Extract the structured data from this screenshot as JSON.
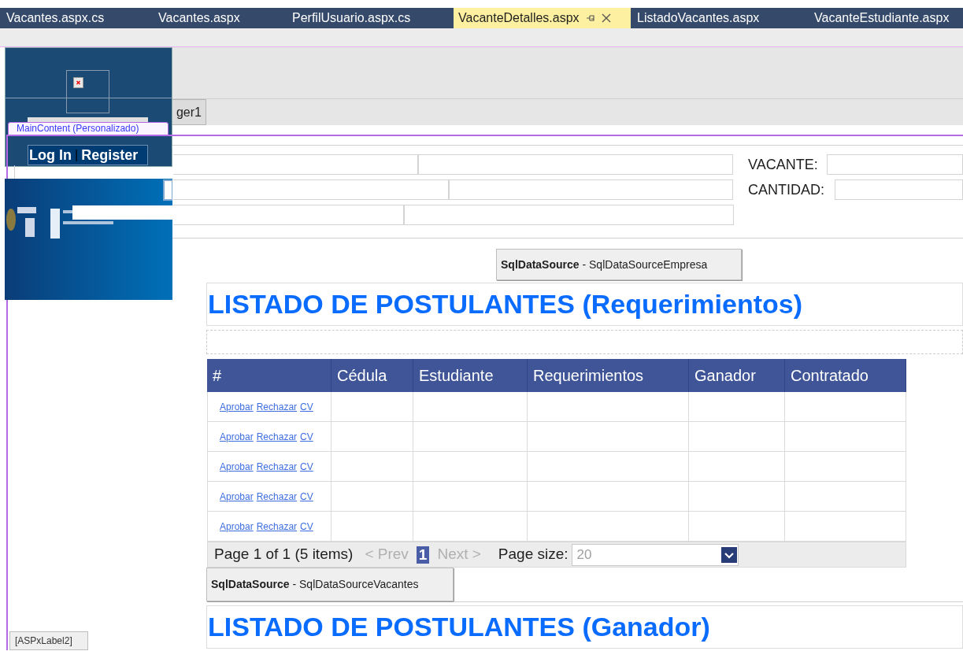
{
  "tabs": [
    {
      "label": "Vacantes.aspx.cs",
      "selected": false
    },
    {
      "label": "Vacantes.aspx",
      "selected": false
    },
    {
      "label": "PerfilUsuario.aspx.cs",
      "selected": false
    },
    {
      "label": "VacanteDetalles.aspx",
      "selected": true
    },
    {
      "label": "ListadoVacantes.aspx",
      "selected": false
    },
    {
      "label": "VacanteEstudiante.aspx",
      "selected": false
    }
  ],
  "designer": {
    "script_manager": "ger1",
    "content_region": "MainContent (Personalizado)",
    "login_links": [
      "Log In",
      "Register"
    ],
    "login_separator": "|",
    "labels": [
      "VACANTE:",
      "CANTIDAD:"
    ],
    "datasource_1": {
      "type": "SqlDataSource",
      "name": " - SqlDataSourceEmpresa"
    },
    "heading_1": "LISTADO DE POSTULANTES (Requerimientos)",
    "grid": {
      "columns": [
        "#",
        "Cédula",
        "Estudiante",
        "Requerimientos",
        "Ganador",
        "Contratado"
      ],
      "rows": [
        {
          "actions": [
            "Aprobar",
            "Rechazar",
            "CV"
          ]
        },
        {
          "actions": [
            "Aprobar",
            "Rechazar",
            "CV"
          ]
        },
        {
          "actions": [
            "Aprobar",
            "Rechazar",
            "CV"
          ]
        },
        {
          "actions": [
            "Aprobar",
            "Rechazar",
            "CV"
          ]
        },
        {
          "actions": [
            "Aprobar",
            "Rechazar",
            "CV"
          ]
        }
      ],
      "pager": {
        "summary": "Page 1 of 1 (5 items)",
        "prev": "< Prev",
        "page": "1",
        "next": "Next >",
        "page_size_label": "Page size:",
        "page_size": "20"
      }
    },
    "datasource_2": {
      "type": "SqlDataSource",
      "name": " - SqlDataSourceVacantes"
    },
    "heading_2": "LISTADO DE POSTULANTES (Ganador)",
    "footer_label": "[ASPxLabel2]"
  }
}
